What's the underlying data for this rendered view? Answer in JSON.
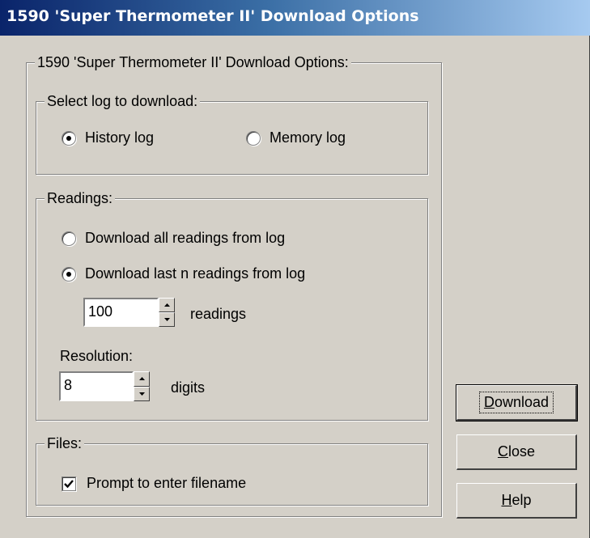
{
  "window": {
    "title": "1590 'Super Thermometer II' Download Options"
  },
  "main_group": {
    "legend": "1590 'Super Thermometer II' Download Options:"
  },
  "log_group": {
    "legend": "Select log to download:",
    "options": [
      {
        "label": "History log",
        "checked": true
      },
      {
        "label": "Memory log",
        "checked": false
      }
    ]
  },
  "readings_group": {
    "legend": "Readings:",
    "options": [
      {
        "label": "Download all readings from log",
        "checked": false
      },
      {
        "label": "Download last n readings from log",
        "checked": true
      }
    ],
    "count": {
      "value": "100",
      "unit": "readings"
    },
    "resolution": {
      "label": "Resolution:",
      "value": "8",
      "unit": "digits"
    }
  },
  "files_group": {
    "legend": "Files:",
    "prompt_filename": {
      "label": "Prompt to enter filename",
      "checked": true
    }
  },
  "buttons": {
    "download": {
      "mnemonic": "D",
      "rest": "ownload"
    },
    "close": {
      "mnemonic": "C",
      "rest": "lose"
    },
    "help": {
      "mnemonic": "H",
      "rest": "elp"
    }
  },
  "icons": {
    "spin_up": "spin-up-arrow-icon",
    "spin_down": "spin-down-arrow-icon",
    "check": "checkmark-icon"
  }
}
